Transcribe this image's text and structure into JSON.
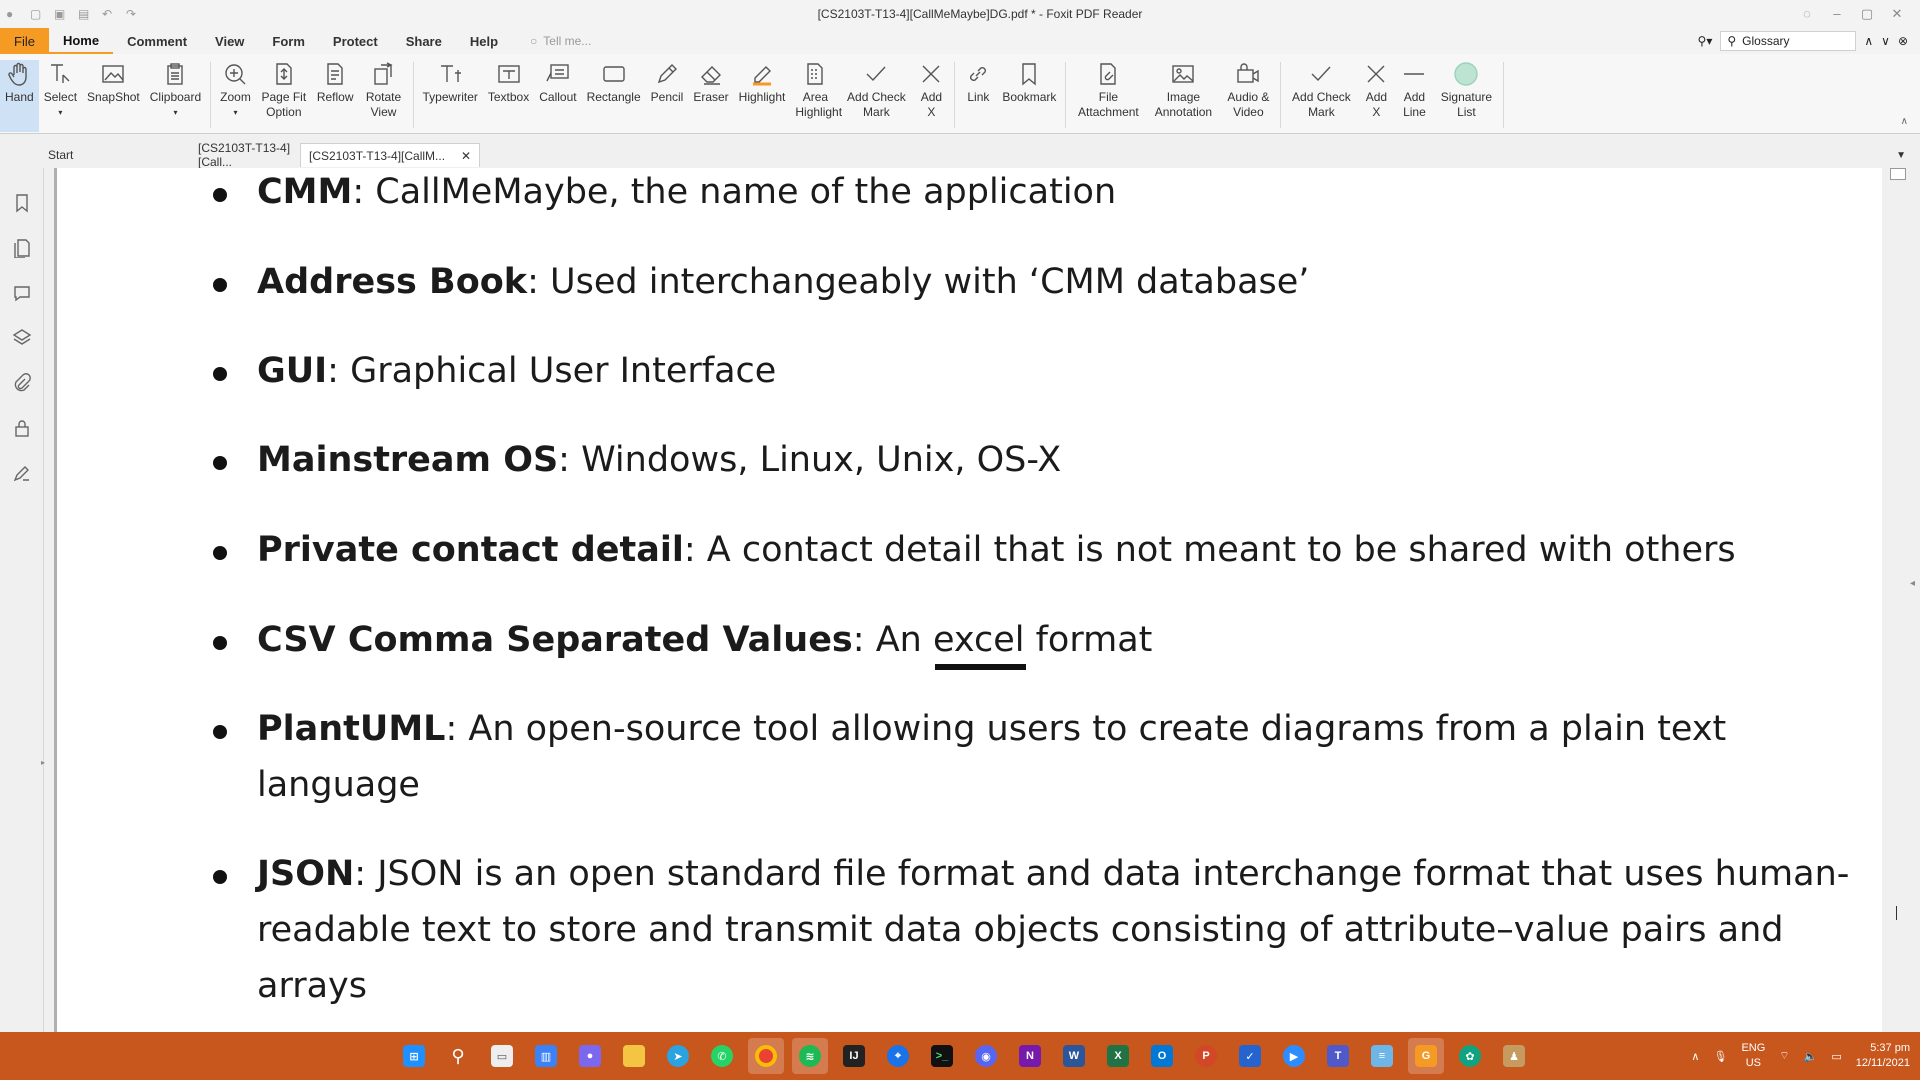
{
  "window": {
    "title": "[CS2103T-T13-4][CallMeMaybe]DG.pdf * - Foxit PDF Reader"
  },
  "menu": {
    "items": [
      "File",
      "Home",
      "Comment",
      "View",
      "Form",
      "Protect",
      "Share",
      "Help"
    ],
    "active": "Home",
    "tell_me_placeholder": "Tell me...",
    "search_value": "Glossary"
  },
  "ribbon": {
    "tools": [
      {
        "label": "Hand",
        "icon": "hand-icon"
      },
      {
        "label": "Select",
        "icon": "select-text-icon"
      },
      {
        "label": "SnapShot",
        "icon": "snapshot-icon"
      },
      {
        "label": "Clipboard",
        "icon": "clipboard-icon"
      },
      {
        "label": "Zoom",
        "icon": "zoom-icon"
      },
      {
        "label": "Page Fit Option",
        "icon": "page-fit-icon"
      },
      {
        "label": "Reflow",
        "icon": "reflow-icon"
      },
      {
        "label": "Rotate View",
        "icon": "rotate-view-icon"
      },
      {
        "label": "Typewriter",
        "icon": "typewriter-icon"
      },
      {
        "label": "Textbox",
        "icon": "textbox-icon"
      },
      {
        "label": "Callout",
        "icon": "callout-icon"
      },
      {
        "label": "Rectangle",
        "icon": "rectangle-icon"
      },
      {
        "label": "Pencil",
        "icon": "pencil-icon"
      },
      {
        "label": "Eraser",
        "icon": "eraser-icon"
      },
      {
        "label": "Highlight",
        "icon": "highlight-icon"
      },
      {
        "label": "Area Highlight",
        "icon": "area-highlight-icon"
      },
      {
        "label": "Add Check Mark",
        "icon": "check-mark-icon"
      },
      {
        "label": "Add X",
        "icon": "x-mark-icon"
      },
      {
        "label": "Link",
        "icon": "link-icon"
      },
      {
        "label": "Bookmark",
        "icon": "bookmark-icon"
      },
      {
        "label": "File Attachment",
        "icon": "file-attachment-icon"
      },
      {
        "label": "Image Annotation",
        "icon": "image-annotation-icon"
      },
      {
        "label": "Audio & Video",
        "icon": "audio-video-icon"
      },
      {
        "label": "Add Check Mark",
        "icon": "check-mark-icon"
      },
      {
        "label": "Add X",
        "icon": "x-mark-icon"
      },
      {
        "label": "Add Line",
        "icon": "line-icon"
      },
      {
        "label": "Signature List",
        "icon": "signature-icon"
      }
    ]
  },
  "tabs": {
    "start": "Start",
    "doc1": "[CS2103T-T13-4][Call...",
    "doc2": "[CS2103T-T13-4][CallM..."
  },
  "document": {
    "items": [
      {
        "term": "CMM",
        "desc": ": CallMeMaybe, the name of the application"
      },
      {
        "term": "Address Book",
        "desc": ": Used interchangeably with ‘CMM database’"
      },
      {
        "term": "GUI",
        "desc": ": Graphical User Interface"
      },
      {
        "term": "Mainstream OS",
        "desc": ": Windows, Linux, Unix, OS-X"
      },
      {
        "term": "Private contact detail",
        "desc": ": A contact detail that is not meant to be shared with others"
      },
      {
        "term": "CSV Comma Separated Values",
        "desc_pre": ": An ",
        "desc_ul": "excel",
        "desc_post": " format"
      },
      {
        "term": "PlantUML",
        "desc": ": An open-source tool allowing users to create diagrams from a plain text",
        "desc2": "language"
      },
      {
        "term": "JSON",
        "desc": ": JSON is an open standard file format and data interchange format that uses human-",
        "desc2": "readable text to store and transmit data objects consisting of attribute–value pairs and arrays"
      }
    ]
  },
  "taskbar": {
    "lang_top": "ENG",
    "lang_bottom": "US",
    "time": "5:37 pm",
    "date": "12/11/2021"
  },
  "colors": {
    "accent": "#f59a23",
    "taskbar": "#c8571e",
    "active_tool": "#cfe1f5"
  }
}
